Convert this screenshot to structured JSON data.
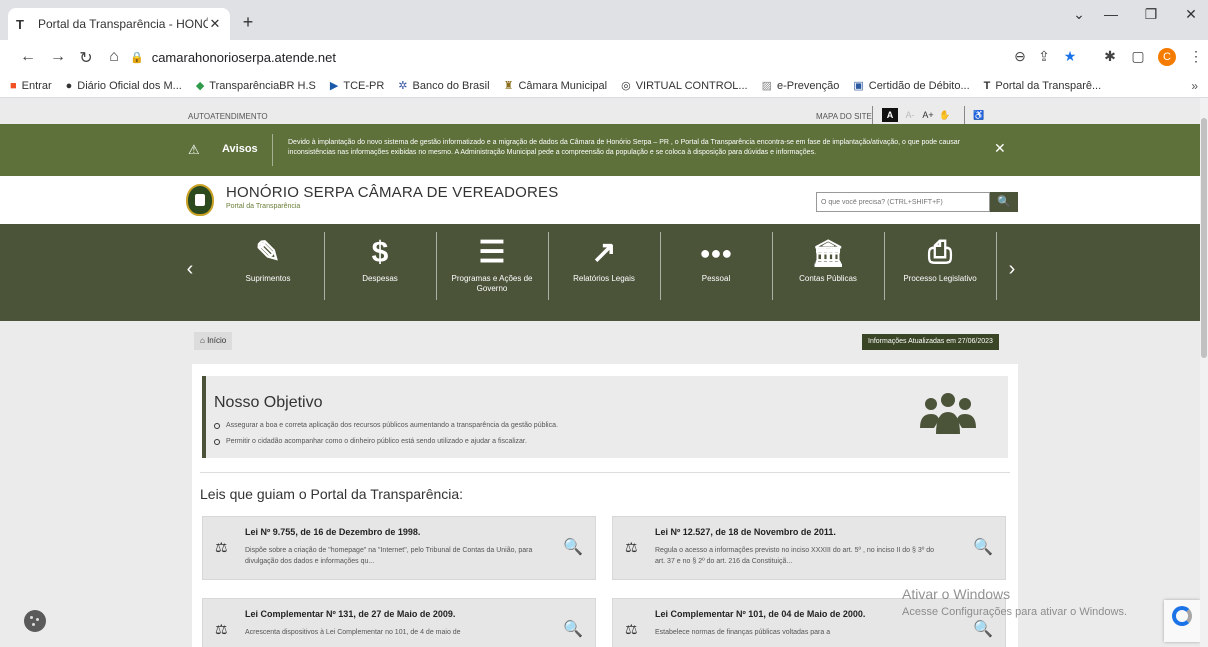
{
  "browser": {
    "tab_title": "Portal da Transparência - HONÓF",
    "tab_favicon": "T",
    "url": "camarahonorioserpa.atende.net",
    "profile_initial": "C",
    "bookmarks": [
      {
        "label": "Entrar",
        "icon": "windows-icon"
      },
      {
        "label": "Diário Oficial dos M...",
        "icon": "sf-icon"
      },
      {
        "label": "TransparênciaBR H.S",
        "icon": "diamond-icon"
      },
      {
        "label": "TCE-PR",
        "icon": "play-icon"
      },
      {
        "label": "Banco do Brasil",
        "icon": "bb-icon"
      },
      {
        "label": "Câmara Municipal",
        "icon": "crest-icon"
      },
      {
        "label": "VIRTUAL CONTROL...",
        "icon": "globe-icon"
      },
      {
        "label": "e-Prevenção",
        "icon": "image-icon"
      },
      {
        "label": "Certidão de Débito...",
        "icon": "cert-icon"
      },
      {
        "label": "Portal da Transparê...",
        "icon": "t-icon"
      }
    ],
    "more": "»"
  },
  "topbar": {
    "autoatendimento": "AUTOATENDIMENTO",
    "mapa": "MAPA DO SITE",
    "acc_a": "A",
    "acc_minus": "A-",
    "acc_plus": "A+"
  },
  "avisos": {
    "title": "Avisos",
    "text": "Devido à implantação do novo sistema de gestão informatizado e a migração de dados da Câmara de Honório Serpa – PR , o Portal da Transparência encontra-se em fase de implantação/ativação, o que pode causar inconsistências nas informações exibidas no mesmo. A Administração Municipal pede a compreensão da população e se coloca à disposição para dúvidas e informações.",
    "close": "✕"
  },
  "header": {
    "title": "HONÓRIO SERPA CÂMARA DE VEREADORES",
    "subtitle": "Portal da Transparência",
    "search_placeholder": "O que você precisa? (CTRL+SHIFT+F)"
  },
  "menu": [
    {
      "label": "Suprimentos",
      "glyph": "✎",
      "icon": "edit-icon"
    },
    {
      "label": "Despesas",
      "glyph": "$",
      "icon": "dollar-icon"
    },
    {
      "label": "Programas e Ações de Governo",
      "glyph": "☰",
      "icon": "checklist-icon"
    },
    {
      "label": "Relatórios Legais",
      "glyph": "↗",
      "icon": "line-chart-icon"
    },
    {
      "label": "Pessoal",
      "glyph": "●●●",
      "icon": "people-icon"
    },
    {
      "label": "Contas Públicas",
      "glyph": "🏛",
      "icon": "bank-icon"
    },
    {
      "label": "Processo Legislativo",
      "glyph": "⎙",
      "icon": "printer-icon"
    }
  ],
  "breadcrumb": {
    "label": "Início"
  },
  "updated": "Informações Atualizadas em 27/06/2023",
  "objetivo": {
    "title": "Nosso Objetivo",
    "items": [
      "Assegurar a boa e correta aplicação dos recursos públicos aumentando a transparência da gestão pública.",
      "Permitir o cidadão acompanhar como o dinheiro público está sendo utilizado e ajudar a fiscalizar."
    ]
  },
  "leis": {
    "title": "Leis que guiam o Portal da Transparência:",
    "items": [
      {
        "title": "Lei Nº 9.755, de 16 de Dezembro de 1998.",
        "desc": "Dispõe sobre a criação de \"homepage\" na \"Internet\", pelo Tribunal de Contas da União, para divulgação dos dados e informações qu..."
      },
      {
        "title": "Lei Nº 12.527, de 18 de Novembro de 2011.",
        "desc": "Regula o acesso a informações previsto no inciso XXXIII do art. 5º , no inciso II do § 3º do art. 37 e no § 2º do art. 216 da Constituiçã..."
      },
      {
        "title": "Lei Complementar Nº 131, de 27 de Maio de 2009.",
        "desc": "Acrescenta dispositivos à Lei Complementar no 101, de 4 de maio de"
      },
      {
        "title": "Lei Complementar Nº 101, de 04 de Maio de 2000.",
        "desc": "Estabelece normas de finanças públicas voltadas para a"
      }
    ]
  },
  "watermark": {
    "line1": "Ativar o Windows",
    "line2": "Acesse Configurações para ativar o Windows."
  }
}
